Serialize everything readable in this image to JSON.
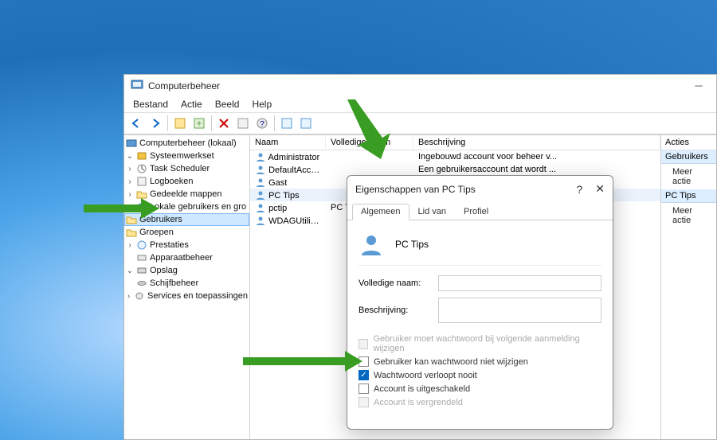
{
  "window": {
    "title": "Computerbeheer",
    "menus": {
      "file": "Bestand",
      "action": "Actie",
      "view": "Beeld",
      "help": "Help"
    }
  },
  "tree": {
    "root": "Computerbeheer (lokaal)",
    "system": "Systeemwerkset",
    "task_scheduler": "Task Scheduler",
    "event_viewer": "Logboeken",
    "shared_folders": "Gedeelde mappen",
    "local_users": "Lokale gebruikers en gro",
    "users": "Gebruikers",
    "groups": "Groepen",
    "performance": "Prestaties",
    "device_manager": "Apparaatbeheer",
    "storage": "Opslag",
    "disk_mgmt": "Schijfbeheer",
    "services_apps": "Services en toepassingen"
  },
  "list": {
    "cols": {
      "name": "Naam",
      "full": "Volledige naam",
      "desc": "Beschrijving"
    },
    "rows": [
      {
        "name": "Administrator",
        "full": "",
        "desc": "Ingebouwd account voor beheer v..."
      },
      {
        "name": "DefaultAcco...",
        "full": "",
        "desc": "Een gebruikersaccount dat wordt ..."
      },
      {
        "name": "Gast",
        "full": "",
        "desc": ""
      },
      {
        "name": "PC Tips",
        "full": "",
        "desc": ""
      },
      {
        "name": "pctip",
        "full": "PC Tips",
        "desc": ""
      },
      {
        "name": "WDAGUtility...",
        "full": "",
        "desc": ""
      }
    ]
  },
  "actions": {
    "header": "Acties",
    "group1": "Gebruikers",
    "item1": "Meer actie",
    "group2": "PC Tips",
    "item2": "Meer actie"
  },
  "dialog": {
    "title": "Eigenschappen van PC Tips",
    "tabs": {
      "general": "Algemeen",
      "memberof": "Lid van",
      "profile": "Profiel"
    },
    "username": "PC Tips",
    "labels": {
      "fullname": "Volledige naam:",
      "description": "Beschrijving:"
    },
    "fields": {
      "fullname": "",
      "description": ""
    },
    "checks": {
      "mustchange": "Gebruiker moet wachtwoord bij volgende aanmelding wijzigen",
      "cannotchange": "Gebruiker kan wachtwoord niet wijzigen",
      "neverexpire": "Wachtwoord verloopt nooit",
      "disabled": "Account is uitgeschakeld",
      "locked": "Account is vergrendeld"
    }
  }
}
